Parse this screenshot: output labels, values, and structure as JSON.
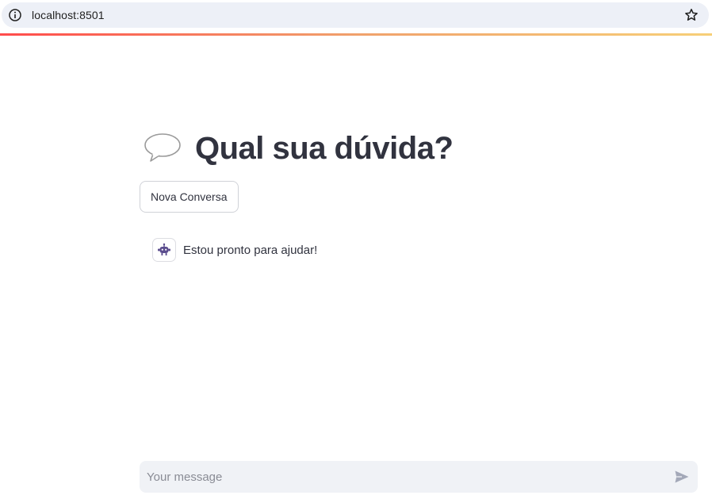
{
  "browser": {
    "url": "localhost:8501"
  },
  "page": {
    "title": "Qual sua dúvida?",
    "title_icon": "speech-balloon-icon"
  },
  "actions": {
    "new_chat_label": "Nova Conversa"
  },
  "messages": [
    {
      "role": "assistant",
      "avatar_icon": "robot-icon",
      "text": "Estou pronto para ajudar!"
    }
  ],
  "chat_input": {
    "placeholder": "Your message"
  },
  "colors": {
    "text": "#31333f",
    "input_bg": "#f0f2f6",
    "accent_start": "#ff4b4b",
    "accent_end": "#f7cf78",
    "avatar_icon": "#5b4d8e"
  }
}
